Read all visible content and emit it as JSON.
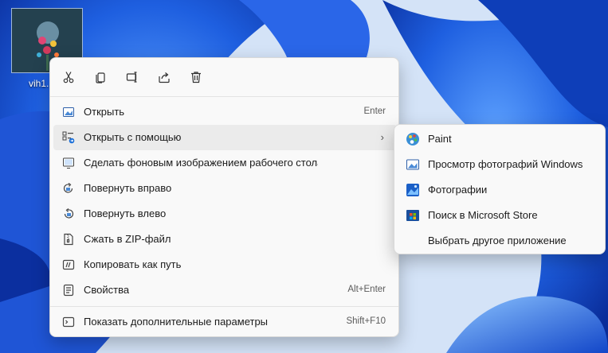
{
  "desktop": {
    "file_label": "vih1."
  },
  "toolbar": {
    "buttons": [
      {
        "icon": "cut-icon"
      },
      {
        "icon": "copy-icon"
      },
      {
        "icon": "rename-icon"
      },
      {
        "icon": "share-icon"
      },
      {
        "icon": "delete-icon"
      }
    ]
  },
  "menu": {
    "items": [
      {
        "label": "Открыть",
        "shortcut": "Enter",
        "icon": "open-image-icon"
      },
      {
        "label": "Открыть с помощью",
        "shortcut": "",
        "arrow": "›",
        "icon": "open-with-icon"
      },
      {
        "label": "Сделать фоновым изображением рабочего стола",
        "shortcut": "",
        "icon": "wallpaper-icon"
      },
      {
        "label": "Повернуть вправо",
        "shortcut": "",
        "icon": "rotate-right-icon"
      },
      {
        "label": "Повернуть влево",
        "shortcut": "",
        "icon": "rotate-left-icon"
      },
      {
        "label": "Сжать в ZIP-файл",
        "shortcut": "",
        "icon": "zip-icon"
      },
      {
        "label": "Копировать как путь",
        "shortcut": "",
        "icon": "copy-path-icon"
      },
      {
        "label": "Свойства",
        "shortcut": "Alt+Enter",
        "icon": "properties-icon"
      },
      {
        "label": "Показать дополнительные параметры",
        "shortcut": "Shift+F10",
        "icon": "more-options-icon"
      }
    ]
  },
  "submenu": {
    "items": [
      {
        "label": "Paint",
        "icon": "paint-icon"
      },
      {
        "label": "Просмотр фотографий Windows",
        "icon": "photo-viewer-icon"
      },
      {
        "label": "Фотографии",
        "icon": "photos-icon"
      },
      {
        "label": "Поиск в Microsoft Store",
        "icon": "store-icon"
      },
      {
        "label": "Выбрать другое приложение",
        "icon": ""
      }
    ]
  },
  "colors": {
    "wallpaper_blue": "#2f6fe6",
    "menu_bg": "#f9f9f9",
    "hover_bg": "#ebebeb",
    "accent": "#0067c0"
  }
}
